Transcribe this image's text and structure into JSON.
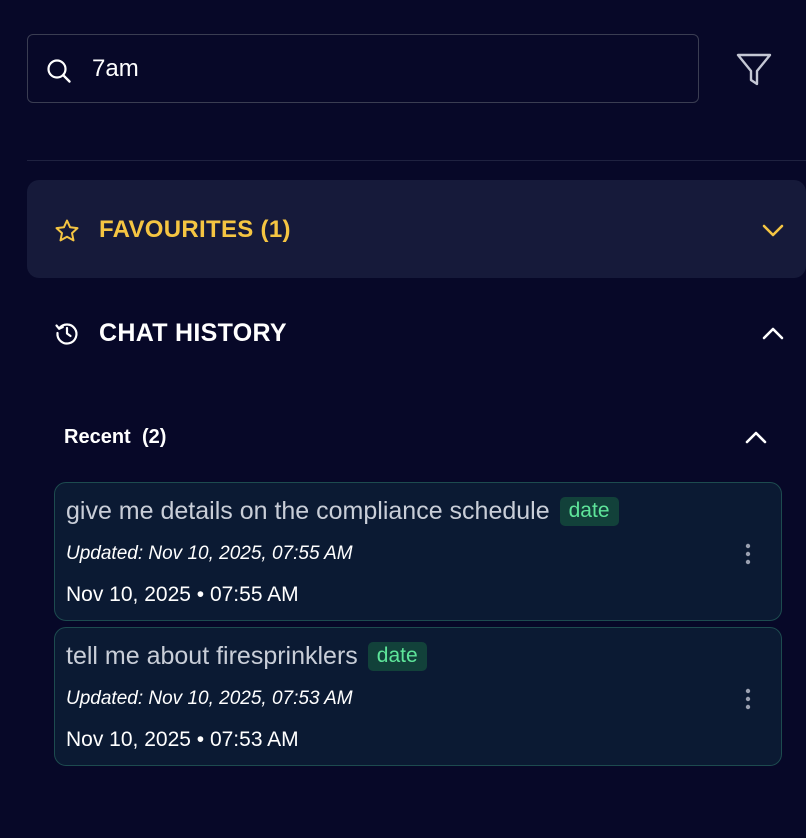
{
  "search": {
    "value": "7am",
    "icon": "search-icon"
  },
  "filter": {
    "icon": "filter-icon"
  },
  "favourites": {
    "label": "FAVOURITES (1)",
    "icon": "star-icon",
    "expanded": false,
    "accent_color": "#f5c542"
  },
  "chat_history": {
    "label": "CHAT HISTORY",
    "icon": "history-icon",
    "expanded": true
  },
  "recent": {
    "label": "Recent",
    "count": "(2)",
    "expanded": true
  },
  "chats": [
    {
      "title": "give me details on the compliance schedule",
      "badge": "date",
      "updated": "Updated: Nov 10, 2025, 07:55 AM",
      "date": "Nov 10, 2025 • 07:55 AM"
    },
    {
      "title": "tell me about firesprinklers",
      "badge": "date",
      "updated": "Updated: Nov 10, 2025, 07:53 AM",
      "date": "Nov 10, 2025 • 07:53 AM"
    }
  ],
  "colors": {
    "background": "#070828",
    "panel": "#161a3a",
    "card": "#0b1a33",
    "card_border": "#1d4b4f",
    "badge_bg": "#12413a",
    "badge_text": "#5ee59a"
  }
}
